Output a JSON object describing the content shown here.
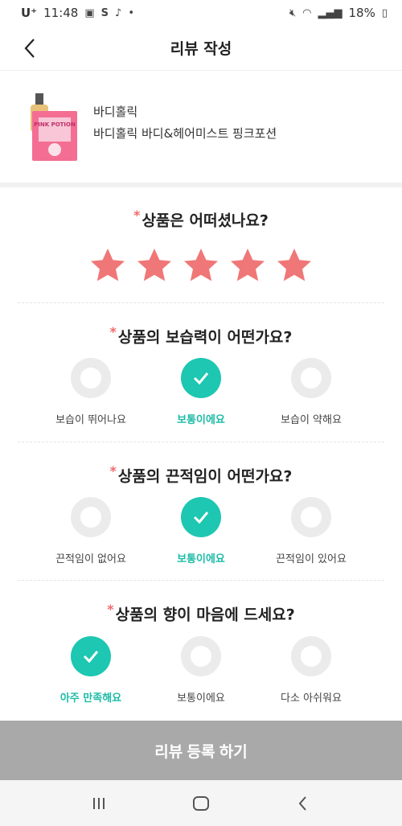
{
  "status": {
    "carrier": "U⁺",
    "time": "11:48",
    "battery": "18%"
  },
  "header": {
    "title": "리뷰 작성"
  },
  "product": {
    "brand": "바디홀릭",
    "name": "바디홀릭 바디&헤어미스트 핑크포션",
    "image_label": "PINK POTION"
  },
  "rating": {
    "question": "상품은 어떠셨나요?",
    "value": 5,
    "max": 5
  },
  "questions": [
    {
      "question": "상품의 보습력이 어떤가요?",
      "options": [
        "보습이 뛰어나요",
        "보통이에요",
        "보습이 약해요"
      ],
      "selected": 1
    },
    {
      "question": "상품의 끈적임이 어떤가요?",
      "options": [
        "끈적임이 없어요",
        "보통이에요",
        "끈적임이 있어요"
      ],
      "selected": 1
    },
    {
      "question": "상품의 향이 마음에 드세요?",
      "options": [
        "아주 만족해요",
        "보통이에요",
        "다소 아쉬워요"
      ],
      "selected": 0
    }
  ],
  "required_mark": "*",
  "submit": {
    "label": "리뷰 등록 하기"
  },
  "colors": {
    "accent": "#1dc7b1",
    "star": "#f07777",
    "submit_bg": "#a9a9a9"
  }
}
